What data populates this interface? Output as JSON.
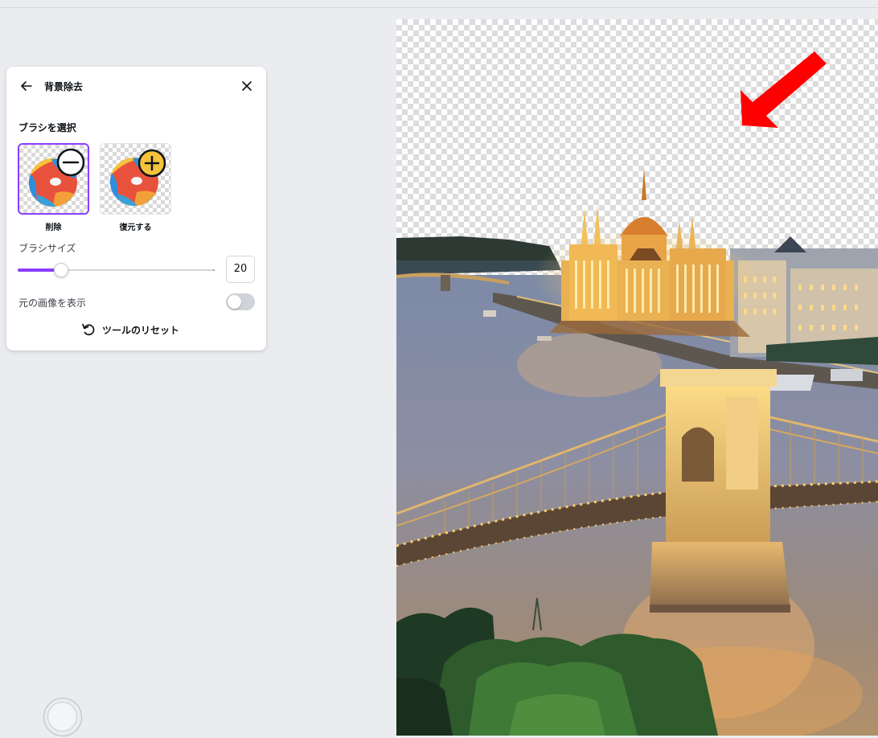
{
  "panel": {
    "title": "背景除去",
    "back_icon": "arrow-left-icon",
    "close_icon": "close-icon",
    "brush_section_label": "ブラシを選択",
    "brushes": [
      {
        "label": "削除",
        "icon": "minus-circle-icon",
        "selected": true
      },
      {
        "label": "復元する",
        "icon": "plus-circle-icon",
        "selected": false
      }
    ],
    "brush_size_label": "ブラシサイズ",
    "brush_size_value": "20",
    "brush_size_fraction": 0.22,
    "show_original_label": "元の画像を表示",
    "show_original_on": false,
    "reset_label": "ツールのリセット",
    "reset_icon": "undo-icon"
  },
  "colors": {
    "accent": "#8b3dff",
    "annotation_arrow": "#ff0000",
    "background": "#ebecf0"
  },
  "canvas": {
    "image": "budapest-parliament-chain-bridge-photo",
    "annotation": "red-arrow-icon"
  }
}
